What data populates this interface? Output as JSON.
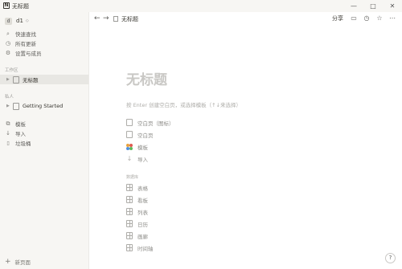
{
  "window": {
    "title": "无标题",
    "app_icon": "N",
    "min_glyph": "—",
    "max_glyph": "□",
    "close_glyph": "✕"
  },
  "sidebar": {
    "workspace_avatar": "d",
    "workspace_name": "d1",
    "chevron": "◇",
    "nav": [
      {
        "label": "快速查找",
        "icon": "search-icon",
        "glyph": "⌕"
      },
      {
        "label": "所有更新",
        "icon": "clock-icon",
        "glyph": "◷"
      },
      {
        "label": "设置与成员",
        "icon": "gear-icon",
        "glyph": "⚙"
      }
    ],
    "workspace_section": "工作区",
    "workspace_pages": [
      {
        "label": "无标题"
      }
    ],
    "private_section": "私人",
    "private_pages": [
      {
        "label": "Getting Started"
      }
    ],
    "tools": [
      {
        "label": "模板",
        "icon": "template-icon",
        "glyph": "⧉"
      },
      {
        "label": "导入",
        "icon": "import-icon",
        "glyph": "↓"
      },
      {
        "label": "垃圾桶",
        "icon": "trash-icon",
        "glyph": "🗑"
      }
    ],
    "new_page": "新页面"
  },
  "topbar": {
    "back": "←",
    "forward": "→",
    "breadcrumb": "无标题",
    "share": "分享",
    "comment_glyph": "▭",
    "history_glyph": "◷",
    "favorite_glyph": "☆",
    "more_glyph": "⋯"
  },
  "page": {
    "title": "无标题",
    "hint": "按 Enter 创建空白页，或选择模板（↑↓来选择）",
    "options": [
      {
        "label": "空白页（图标）",
        "icon": "doc-icon"
      },
      {
        "label": "空白页",
        "icon": "doc-icon"
      },
      {
        "label": "模板",
        "icon": "template-icon"
      },
      {
        "label": "导入",
        "icon": "import-icon"
      }
    ],
    "db_section": "数据库",
    "databases": [
      {
        "label": "表格",
        "icon": "table-icon"
      },
      {
        "label": "看板",
        "icon": "board-icon"
      },
      {
        "label": "列表",
        "icon": "list-icon"
      },
      {
        "label": "日历",
        "icon": "calendar-icon"
      },
      {
        "label": "画廊",
        "icon": "gallery-icon"
      },
      {
        "label": "时间轴",
        "icon": "timeline-icon"
      }
    ]
  },
  "help": "?",
  "colors": {
    "sidebar_bg": "#f7f6f3",
    "active_bg": "#e8e7e3",
    "placeholder": "#c9c8c5"
  }
}
